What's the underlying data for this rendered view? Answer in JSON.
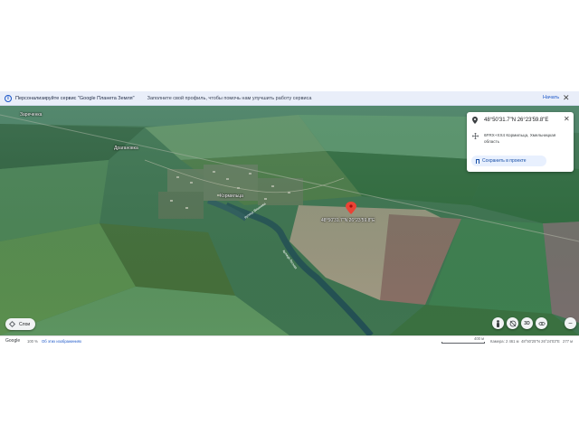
{
  "banner": {
    "title": "Персонализируйте сервис \"Google Планета Земля\"",
    "subtitle": "Заполните свой профиль, чтобы помочь нам улучшить работу сервиса",
    "start_label": "Начать"
  },
  "map": {
    "place_labels": {
      "zarechanka": "Зареченка",
      "draganovka": "Драгановка",
      "kormiltsi": "Кормильца"
    },
    "road_labels": {
      "road_a": "вулиця Вишнева",
      "road_b": "вулиця Лесная"
    },
    "pin_label": "48°50'31.7\"N 26°23'59.8\"E"
  },
  "card": {
    "coordinates": "48°50'31.7\"N 26°23'59.8\"E",
    "address": "6FRX+XX4 Кормильца, Хмельницкая область",
    "save_label": "Сохранить в проекте"
  },
  "layers": {
    "label": "Слои"
  },
  "controls": {
    "pegman": "pegman-icon",
    "compass_off": "compass-off-icon",
    "view_3d": "3D",
    "orbit": "orbit-icon",
    "zoom_minus": "−"
  },
  "status": {
    "logo": "Google",
    "zoom": "100 %",
    "imagery": "Об этих изображениях",
    "scale": "400 м",
    "camera": "Камера: 2 461 м",
    "coords": "48°50'25\"N 26°24'03\"E",
    "elevation": "277 м"
  },
  "colors": {
    "accent": "#1a56c8",
    "pin": "#ea4335",
    "banner_bg": "#e9eef9"
  }
}
